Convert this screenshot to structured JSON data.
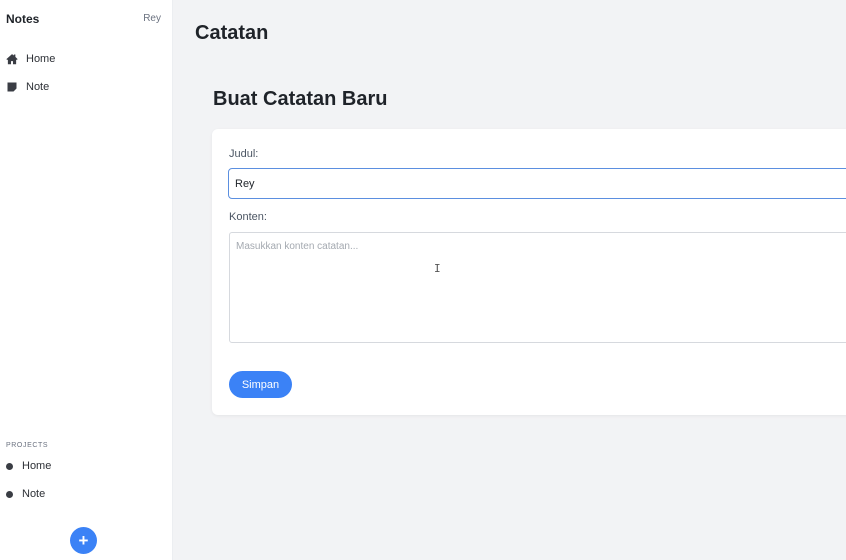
{
  "sidebar": {
    "brand": "Notes",
    "user": "Rey",
    "nav": [
      {
        "label": "Home",
        "icon": "home-icon"
      },
      {
        "label": "Note",
        "icon": "note-icon"
      }
    ],
    "projects_title": "PROJECTS",
    "projects": [
      {
        "label": "Home"
      },
      {
        "label": "Note"
      }
    ],
    "fab_label": "+"
  },
  "main": {
    "page_title": "Catatan",
    "section_title": "Buat Catatan Baru",
    "form": {
      "title_label": "Judul:",
      "title_value": "Rey",
      "content_label": "Konten:",
      "content_placeholder": "Masukkan konten catatan...",
      "save_label": "Simpan"
    }
  },
  "colors": {
    "accent": "#3b82f6",
    "background": "#f2f3f5",
    "card": "#ffffff"
  }
}
